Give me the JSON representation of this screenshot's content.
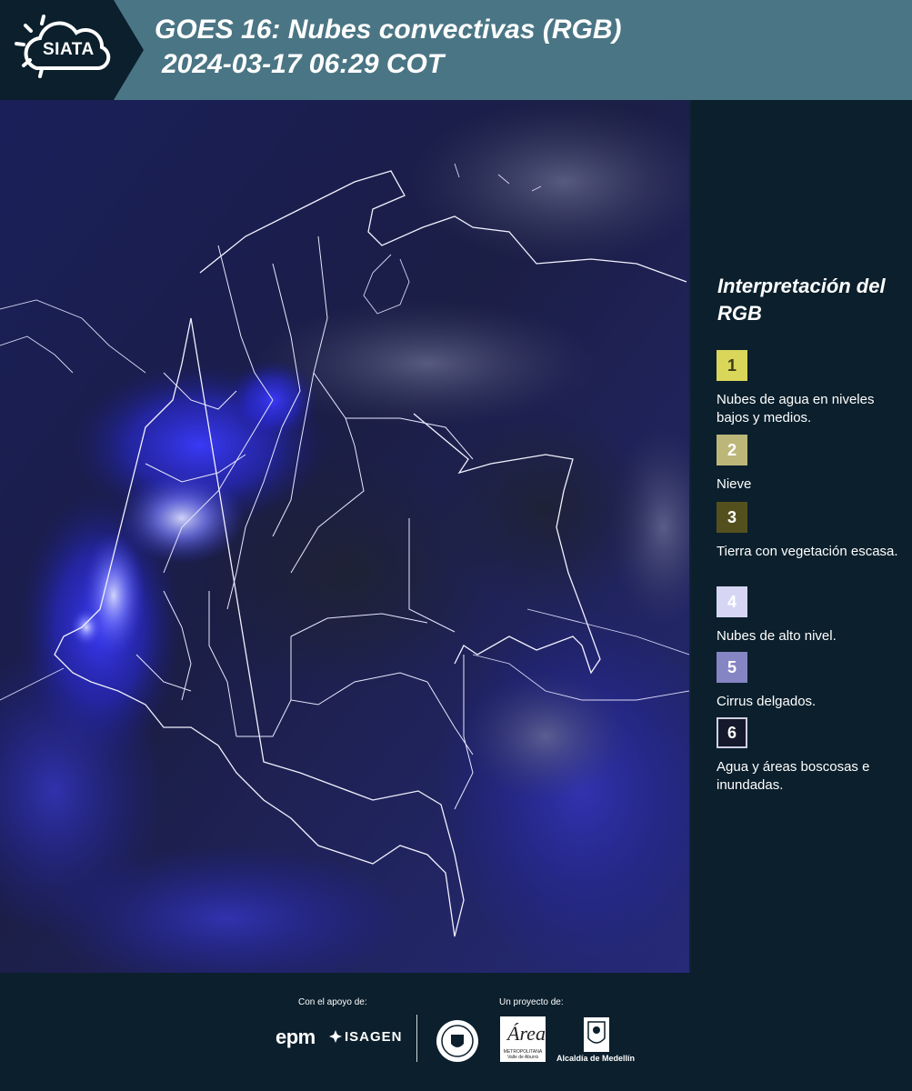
{
  "header": {
    "logo_text": "SIATA",
    "title_line1": "GOES 16: Nubes convectivas (RGB)",
    "title_line2": "2024-03-17 06:29 COT"
  },
  "map": {
    "icon": "satellite-map-colombia"
  },
  "legend": {
    "title": "Interpretación del RGB",
    "items": [
      {
        "number": "1",
        "label": "Nubes de agua en niveles bajos y medios.",
        "color": "#d9d65a",
        "text_color": "#3a3a1a"
      },
      {
        "number": "2",
        "label": "Nieve",
        "color": "#bcb779",
        "text_color": "#ffffff"
      },
      {
        "number": "3",
        "label": "Tierra con vegetación escasa.",
        "color": "#54501e",
        "text_color": "#ffffff"
      },
      {
        "number": "4",
        "label": "Nubes de alto nivel.",
        "color": "#d6d6f4",
        "text_color": "#ffffff"
      },
      {
        "number": "5",
        "label": "Cirrus delgados.",
        "color": "#8585c4",
        "text_color": "#ffffff"
      },
      {
        "number": "6",
        "label": "Agua y áreas boscosas e inundadas.",
        "color": "#141a2b",
        "text_color": "#ffffff"
      }
    ]
  },
  "footer": {
    "support_label": "Con el apoyo de:",
    "project_label": "Un proyecto de:",
    "epm": "epm",
    "isagen": "ISAGEN",
    "area_text": "Área",
    "area_subtext": "METROPOLITANA Valle de Aburrá",
    "alcaldia": "Alcaldía de Medellín"
  },
  "colors": {
    "header_bg": "#4a7584",
    "panel_bg": "#0b1f2c"
  }
}
